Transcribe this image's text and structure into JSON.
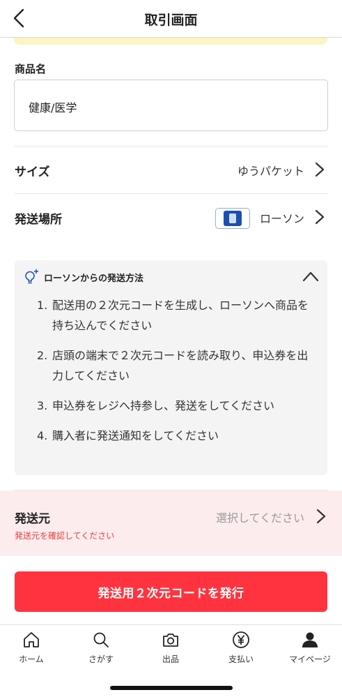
{
  "header": {
    "title": "取引画面"
  },
  "product": {
    "label": "商品名",
    "value": "健康/医学"
  },
  "size_row": {
    "label": "サイズ",
    "value": "ゆうパケット"
  },
  "location_row": {
    "label": "発送場所",
    "value": "ローソン"
  },
  "howto": {
    "title": "ローソンからの発送方法",
    "steps": [
      {
        "num": "1.",
        "text": "配送用の２次元コードを生成し、ローソンへ商品を持ち込んでください"
      },
      {
        "num": "2.",
        "text": "店頭の端末で２次元コードを読み取り、申込券を出力してください"
      },
      {
        "num": "3.",
        "text": "申込券をレジへ持参し、発送をしてください"
      },
      {
        "num": "4.",
        "text": "購入者に発送通知をしてください"
      }
    ]
  },
  "sender": {
    "label": "発送元",
    "placeholder": "選択してください",
    "error": "発送元を確認してください"
  },
  "action": {
    "issue_label": "発送用２次元コードを発行"
  },
  "tabs": [
    {
      "label": "ホーム",
      "icon": "home-icon"
    },
    {
      "label": "さがす",
      "icon": "search-icon"
    },
    {
      "label": "出品",
      "icon": "camera-icon"
    },
    {
      "label": "支払い",
      "icon": "yen-icon"
    },
    {
      "label": "マイページ",
      "icon": "person-icon"
    }
  ],
  "colors": {
    "accent": "#ff333f",
    "error": "#e8403f",
    "notice": "#fdf3c4",
    "sender_bg": "#fdecee",
    "lawson_blue": "#1d4fb0"
  }
}
